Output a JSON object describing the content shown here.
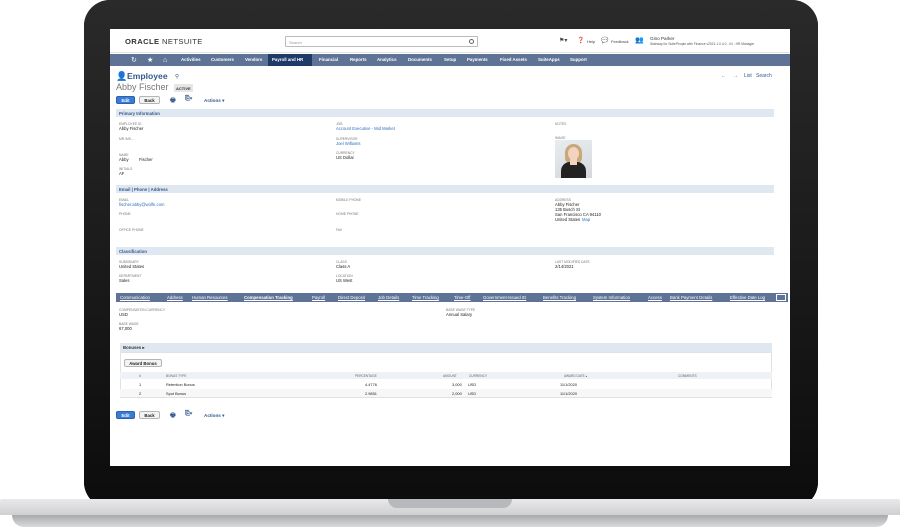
{
  "topbar": {
    "logo_brand": "ORACLE",
    "logo_product": " NETSUITE",
    "search_placeholder": "Search",
    "help": "Help",
    "feedback": "Feedback",
    "user_name": "Gino Parker",
    "user_role": "Stairway for SuitePeople with Finance v2021.1.0.4.0 - IN - HR Manager"
  },
  "nav": {
    "items": [
      "Activities",
      "Customers",
      "Vendors",
      "Payroll and HR",
      "Financial",
      "Reports",
      "Analytics",
      "Documents",
      "Setup",
      "Payments",
      "Fixed Assets",
      "SuiteApps",
      "Support"
    ],
    "active": "Payroll and HR"
  },
  "record": {
    "type": "Employee",
    "name": "Abby Fischer",
    "status": "ACTIVE",
    "list_link": "List",
    "search_link": "Search",
    "edit": "Edit",
    "back": "Back",
    "actions": "Actions ▾"
  },
  "primary": {
    "title": "Primary Information",
    "employee_id_label": "EMPLOYEE ID",
    "employee_id": "Abby Fischer",
    "mr_mrs_label": "MR./MS...",
    "name_label": "NAME",
    "first_name": "Abby",
    "last_name": "Fischer",
    "initials_label": "INITIALS",
    "initials": "AF",
    "job_label": "JOB",
    "job": "Account Executive - Mid Market",
    "supervisor_label": "SUPERVISOR",
    "supervisor": "Joel Williams",
    "currency_label": "CURRENCY",
    "currency": "US Dollar",
    "notes_label": "NOTES",
    "image_label": "IMAGE"
  },
  "contact": {
    "title": "Email | Phone | Address",
    "email_label": "EMAIL",
    "email": "fischer.abby@wolfe.com",
    "phone_label": "PHONE",
    "office_phone_label": "OFFICE PHONE",
    "mobile_label": "MOBILE PHONE",
    "home_label": "HOME PHONE",
    "fax_label": "FAX",
    "address_label": "ADDRESS",
    "address_lines": [
      "Abby Fischer",
      "135 Busch St",
      "San Francisco CA 94110"
    ],
    "address_country": "United States",
    "map_link": "Map"
  },
  "classification": {
    "title": "Classification",
    "subsidiary_label": "SUBSIDIARY",
    "subsidiary": "United States",
    "department_label": "DEPARTMENT",
    "department": "Sales",
    "class_label": "CLASS",
    "class": "Class A",
    "location_label": "LOCATION",
    "location": "US West",
    "modified_label": "LAST MODIFIED DATE",
    "modified": "2/14/2021"
  },
  "tabs": [
    "Communication",
    "Address",
    "Human Resources",
    "Compensation Tracking",
    "Payroll",
    "Direct Deposit",
    "Job Details",
    "Time Tracking",
    "Time-Off",
    "Government-Issued ID",
    "Benefits Tracking",
    "System Information",
    "Access",
    "Bank Payment Details",
    "Effective Date Log"
  ],
  "active_tab": "Compensation Tracking",
  "compensation": {
    "currency_label": "COMPENSATION CURRENCY",
    "currency": "USD",
    "base_wage_label": "BASE WAGE",
    "base_wage": "67,000",
    "base_wage_type_label": "BASE WAGE TYPE",
    "base_wage_type": "Annual Salary"
  },
  "bonuses": {
    "title": "Bonuses ▸",
    "award_button": "Award Bonus",
    "columns": [
      "#",
      "BONUS TYPE",
      "PERCENTAGE",
      "AMOUNT",
      "CURRENCY",
      "AWARD DATE ▴",
      "COMMENTS"
    ],
    "rows": [
      {
        "n": "1",
        "type": "Retention Bonus",
        "pct": "4.4776",
        "amount": "3,000",
        "currency": "USD",
        "date": "11/1/2020"
      },
      {
        "n": "2",
        "type": "Spot Bonus",
        "pct": "2.9851",
        "amount": "2,000",
        "currency": "USD",
        "date": "11/1/2020"
      }
    ]
  },
  "colors": {
    "nav": "#5e7396",
    "nav_active": "#1e3a66",
    "accent": "#3a7bd5",
    "section": "#dfe7f1"
  }
}
